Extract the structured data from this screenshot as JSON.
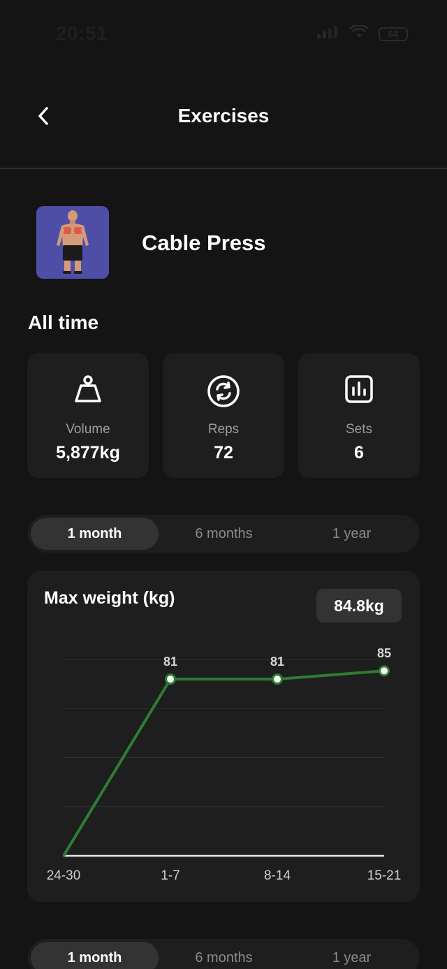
{
  "status_bar": {
    "time": "20:51",
    "battery": "64"
  },
  "nav": {
    "title": "Exercises",
    "back_icon": "chevron-left-icon"
  },
  "exercise": {
    "name": "Cable Press",
    "thumbnail_bg": "#4e4ea6",
    "highlight": "chest"
  },
  "all_time": {
    "title": "All time",
    "stats": [
      {
        "icon": "weight-icon",
        "label": "Volume",
        "value": "5,877kg"
      },
      {
        "icon": "repeat-icon",
        "label": "Reps",
        "value": "72"
      },
      {
        "icon": "bar-chart-icon",
        "label": "Sets",
        "value": "6"
      }
    ]
  },
  "range_tabs": {
    "options": [
      "1 month",
      "6 months",
      "1 year"
    ],
    "selected": "1 month"
  },
  "range_tabs_2": {
    "options": [
      "1 month",
      "6 months",
      "1 year"
    ],
    "selected": "1 month"
  },
  "chart": {
    "title": "Max weight (kg)",
    "badge": "84.8kg"
  },
  "colors": {
    "accent": "#2e7d32",
    "card": "#1e1e1e",
    "background": "#141414"
  },
  "chart_data": {
    "type": "line",
    "title": "Max weight (kg)",
    "categories": [
      "24-30",
      "1-7",
      "8-14",
      "15-21"
    ],
    "series": [
      {
        "values": [
          0,
          81,
          81,
          84.8
        ],
        "labels": [
          "",
          "81",
          "81",
          "85"
        ]
      }
    ],
    "ylim": [
      0,
      90
    ],
    "grid": true
  }
}
